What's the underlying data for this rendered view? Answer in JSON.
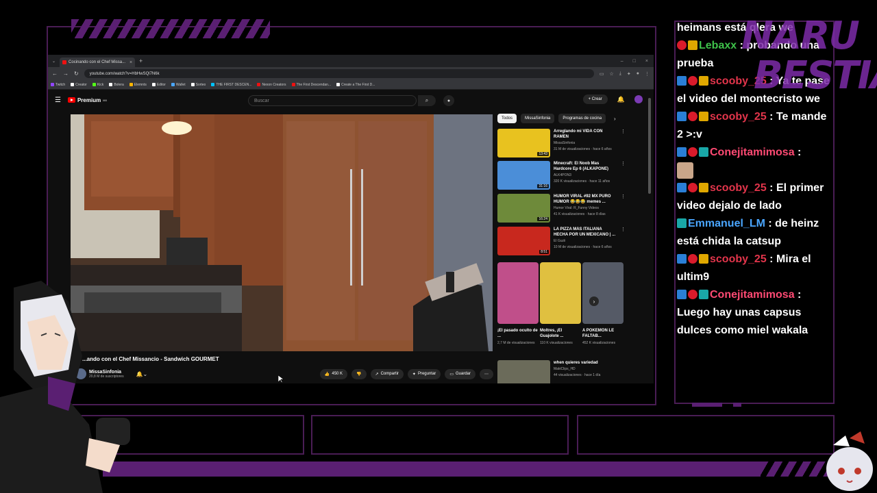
{
  "browser": {
    "tab_title": "Cocinando con el Chef Missa...",
    "url": "youtube.com/watch?v=HbHwSQl7N6k",
    "bookmarks": [
      "Twitch",
      "Creator",
      "Kick",
      "Bolera",
      "Elemnts",
      "Editor",
      "Wallet",
      "Sorteo",
      "THE FIRST DESCEN...",
      "Nexon Creators",
      "The First Descendan...",
      "Create a The First D..."
    ]
  },
  "youtube": {
    "logo_text": "Premium",
    "logo_sup": "MX",
    "search_placeholder": "Buscar",
    "create_label": "Crear",
    "video_title": "...ando con el Chef Missancio - Sandwich GOURMET",
    "channel": {
      "name": "MissaSinfonia",
      "subscribers": "20,8 M de suscriptores"
    },
    "actions": {
      "likes": "450 K",
      "share": "Compartir",
      "ask": "Preguntar",
      "save": "Guardar"
    },
    "chips": [
      "Todos",
      "MissaSinfonia",
      "Programas de cocina"
    ],
    "recommendations": [
      {
        "title": "Arreglando mi VIDA CON RAMEN",
        "channel": "MissaSinfonia",
        "meta": "31 M de visualizaciones · hace 6 años",
        "duration": "13:43",
        "color": "#e8c21f"
      },
      {
        "title": "Minecraft: El Noob Mas Hardcore Ep 6 (ALKAPONE)",
        "channel": "ALK4PON3",
        "meta": "320 K visualizaciones · hace 11 años",
        "duration": "31:16",
        "color": "#4b8ed8"
      },
      {
        "title": "HUMOR VIRAL #92 MX PURO HUMOR 😂😂😂 memes ...",
        "channel": "Humor Viral: R_Funny Videos",
        "meta": "41 K visualizaciones · hace 8 días",
        "duration": "16:24",
        "color": "#6e8a3a"
      },
      {
        "title": "LA PIZZA MÁS ITALIANA HECHA POR UN MEXICANO | ...",
        "channel": "El Guzii",
        "meta": "10 M de visualizaciones · hace 6 años",
        "duration": "8:51",
        "color": "#c8281e"
      }
    ],
    "shorts": [
      {
        "title": "¡El pasado oculto de ...",
        "views": "2,7 M de visualizaciones"
      },
      {
        "title": "Moltres, ¡El Guajolote ...",
        "views": "110 K visualizaciones"
      },
      {
        "title": "A POKEMON LE FALTAB...",
        "views": "452 K visualizaciones"
      }
    ],
    "last_rec": {
      "title": "when quieres variedad",
      "channel": "MakiClips_HD",
      "meta": "44 visualizaciones · hace 1 día"
    }
  },
  "chat": [
    {
      "user": "",
      "text": "heimans está qlera we",
      "badges": []
    },
    {
      "user": "Lebaxx",
      "user_class": "u-green",
      "text": "probando una prueba",
      "badges": [
        "b-sub",
        "b-crown"
      ]
    },
    {
      "user": "scooby_25",
      "user_class": "u-red",
      "text": "Ya te pase el video del montecristo we",
      "badges": [
        "b-prime",
        "b-sub",
        "b-crown"
      ]
    },
    {
      "user": "scooby_25",
      "user_class": "u-red",
      "text": "Te mande 2 >:v",
      "badges": [
        "b-prime",
        "b-sub",
        "b-crown"
      ]
    },
    {
      "user": "Conejitamimosa",
      "user_class": "u-pink",
      "text": "",
      "badges": [
        "b-prime",
        "b-sub",
        "b-mod"
      ],
      "emote": true
    },
    {
      "user": "scooby_25",
      "user_class": "u-red",
      "text": "El primer video dejalo de lado",
      "badges": [
        "b-prime",
        "b-sub",
        "b-crown"
      ]
    },
    {
      "user": "Emmanuel_LM",
      "user_class": "u-blue",
      "text": "de heinz está chida la catsup",
      "badges": [
        "b-mod"
      ]
    },
    {
      "user": "scooby_25",
      "user_class": "u-red",
      "text": "Mira el ultim9",
      "badges": [
        "b-prime",
        "b-sub",
        "b-crown"
      ]
    },
    {
      "user": "Conejitamimosa",
      "user_class": "u-pink",
      "text": "Luego hay unas capsus dulces como miel wakala",
      "badges": [
        "b-prime",
        "b-sub",
        "b-mod"
      ]
    }
  ],
  "brand": {
    "line1": "NARU",
    "line2": "BESTIA"
  }
}
